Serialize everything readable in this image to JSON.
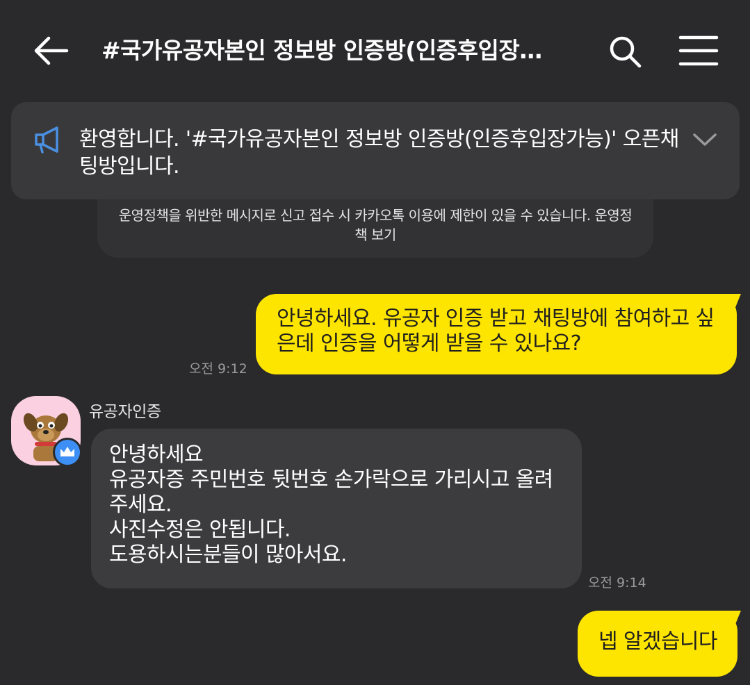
{
  "header": {
    "back_icon": "arrow-left-icon",
    "title": "#국가유공자본인 정보방 인증방(인증후입장…",
    "search_icon": "search-icon",
    "menu_icon": "hamburger-menu-icon"
  },
  "notice": {
    "icon": "megaphone-icon",
    "text": "환영합니다. '#국가유공자본인 정보방 인증방(인증후입장가능)' 오픈채팅방입니다.",
    "expand_icon": "chevron-down-icon"
  },
  "policy": {
    "text": "운영정책을 위반한 메시지로 신고 접수 시 카카오톡 이용에 제한이 있을 수 있습니다.",
    "link": "운영정책 보기"
  },
  "messages": [
    {
      "from": "me",
      "text": "안녕하세요. 유공자 인증 받고 채팅방에 참여하고 싶은데 인증을 어떻게 받을 수 있나요?",
      "time": "오전 9:12"
    },
    {
      "from": "other",
      "sender": "유공자인증",
      "lines": [
        "안녕하세요",
        "유공자증 주민번호 뒷번호 손가락으로 가리시고 올려",
        "주세요.",
        "사진수정은 안됩니다.",
        "도용하시는분들이 많아서요."
      ],
      "time": "오전 9:14"
    },
    {
      "from": "me",
      "text": "넵 알겠습니다"
    }
  ],
  "colors": {
    "background": "#2a2a2c",
    "my_bubble": "#fee500",
    "other_bubble": "#3c3c3e",
    "notice_bg": "#39393b",
    "accent_blue": "#4a90e2"
  }
}
